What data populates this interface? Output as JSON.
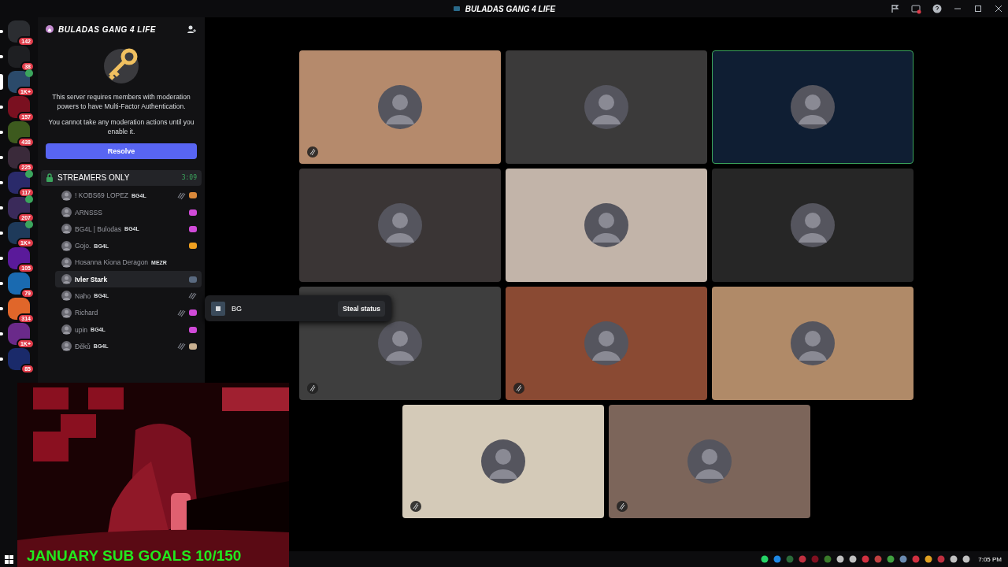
{
  "window": {
    "title": "BULADAS GANG 4 LIFE"
  },
  "servers": [
    {
      "badge": "142",
      "color": "#2b2d31",
      "selected": false,
      "in_voice": false
    },
    {
      "badge": "38",
      "color": "#1e1f22",
      "selected": false,
      "in_voice": false
    },
    {
      "badge": "1K+",
      "color": "#2b4a6a",
      "selected": true,
      "in_voice": true
    },
    {
      "badge": "157",
      "color": "#7a1020",
      "selected": false,
      "in_voice": false
    },
    {
      "badge": "438",
      "color": "#3d5a1e",
      "selected": false,
      "in_voice": false
    },
    {
      "badge": "225",
      "color": "#3a2a3a",
      "selected": false,
      "in_voice": false
    },
    {
      "badge": "117",
      "color": "#2a2a6a",
      "selected": false,
      "in_voice": true
    },
    {
      "badge": "207",
      "color": "#3a2a5a",
      "selected": false,
      "in_voice": true
    },
    {
      "badge": "1K+",
      "color": "#1e3a5a",
      "selected": false,
      "in_voice": true
    },
    {
      "badge": "105",
      "color": "#5a1a9a",
      "selected": false,
      "in_voice": false
    },
    {
      "badge": "79",
      "color": "#1a6ab0",
      "selected": false,
      "in_voice": false
    },
    {
      "badge": "314",
      "color": "#e0662a",
      "selected": false,
      "in_voice": false
    },
    {
      "badge": "1K+",
      "color": "#6a2a8a",
      "selected": false,
      "in_voice": false
    },
    {
      "badge": "85",
      "color": "#1a2a6a",
      "selected": false,
      "in_voice": false
    }
  ],
  "server_header": {
    "name": "BULADAS GANG 4 LIFE"
  },
  "notice": {
    "text": "This server requires members with moderation powers to have Multi-Factor Authentication.",
    "text_2": "You cannot take any moderation actions until you enable it.",
    "button": "Resolve"
  },
  "voice_channel": {
    "name": "STREAMERS ONLY",
    "time": "3:09",
    "members": [
      {
        "name": "! KOBS69 LOPEZ",
        "tag": "BG4L",
        "muted": true,
        "color": "#d9883a",
        "selected": false
      },
      {
        "name": "ARNSSS",
        "muted": false,
        "color": "#d04ad8",
        "selected": false
      },
      {
        "name": "BG4L | Bulodas",
        "tag": "BG4L",
        "muted": false,
        "color": "#d04ad8",
        "selected": false
      },
      {
        "name": "Gojo.",
        "tag": "BG4L",
        "muted": false,
        "color": "#f0a020",
        "selected": false
      },
      {
        "name": "Hosanna Kiona Deragon",
        "tag": "MEZR",
        "muted": false,
        "selected": false
      },
      {
        "name": "Ivler Stark",
        "muted": false,
        "color": "#5a6a80",
        "selected": true
      },
      {
        "name": "Naho",
        "tag": "BG4L",
        "muted": true,
        "selected": false
      },
      {
        "name": "Richard",
        "muted": true,
        "color": "#d04ad8",
        "selected": false
      },
      {
        "name": "upin",
        "tag": "BG4L",
        "muted": false,
        "color": "#d04ad8",
        "selected": false
      },
      {
        "name": "Đěkǔ",
        "tag": "BG4L",
        "muted": true,
        "color": "#c8b090",
        "selected": false
      }
    ]
  },
  "popup": {
    "label": "BG",
    "button": "Steal status"
  },
  "tiles": [
    {
      "color": "#b58a6c",
      "muted": true,
      "speaking": false
    },
    {
      "color": "#3b3a3a",
      "muted": false,
      "speaking": false
    },
    {
      "color": "#0f1e33",
      "muted": false,
      "speaking": true
    },
    {
      "color": "#3a3535",
      "muted": false,
      "speaking": false
    },
    {
      "color": "#c2b4a9",
      "muted": false,
      "speaking": false
    },
    {
      "color": "#262626",
      "muted": false,
      "speaking": false
    },
    {
      "color": "#3e3e3e",
      "muted": true,
      "speaking": false
    },
    {
      "color": "#8a4a33",
      "muted": true,
      "speaking": false
    },
    {
      "color": "#b08a68",
      "muted": false,
      "speaking": false
    },
    {
      "color": "#d4cab8",
      "muted": true,
      "speaking": false
    },
    {
      "color": "#7c655a",
      "muted": true,
      "speaking": false
    }
  ],
  "overlay": {
    "text": "JANUARY SUB GOALS 10/150"
  },
  "taskbar": {
    "time": "7:05 PM"
  }
}
